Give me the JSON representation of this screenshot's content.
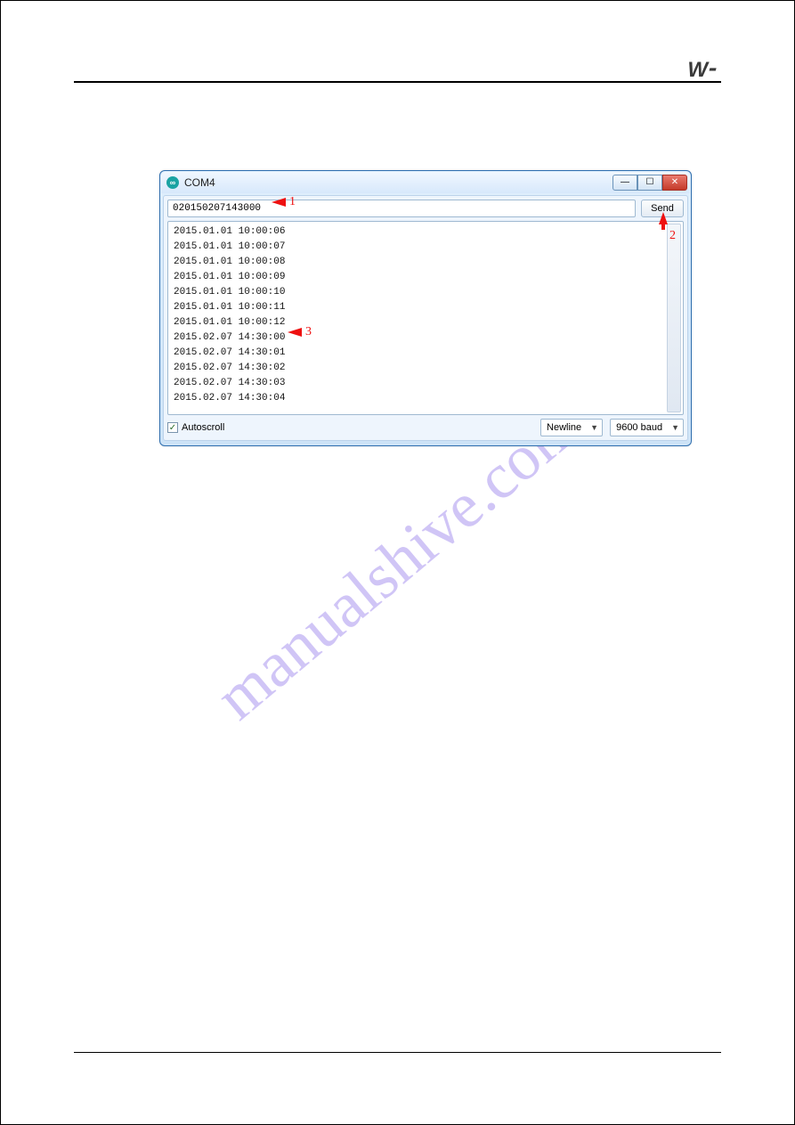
{
  "page": {
    "watermark": "manualshive.com",
    "brand_glyph": "W"
  },
  "serial": {
    "title": "COM4",
    "input_value": "020150207143000",
    "send_label": "Send",
    "autoscroll_label": "Autoscroll",
    "autoscroll_checked": "✓",
    "lineending": "Newline",
    "baud": "9600 baud",
    "lines": [
      "2015.01.01 10:00:06",
      "2015.01.01 10:00:07",
      "2015.01.01 10:00:08",
      "2015.01.01 10:00:09",
      "2015.01.01 10:00:10",
      "2015.01.01 10:00:11",
      "2015.01.01 10:00:12",
      "2015.02.07 14:30:00",
      "2015.02.07 14:30:01",
      "2015.02.07 14:30:02",
      "2015.02.07 14:30:03",
      "2015.02.07 14:30:04"
    ]
  },
  "annotations": {
    "n1": "1",
    "n2": "2",
    "n3": "3"
  }
}
